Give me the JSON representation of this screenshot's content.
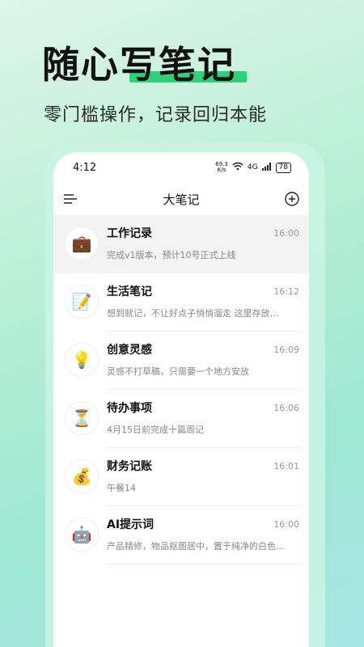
{
  "hero": {
    "title": "随心写笔记",
    "subtitle": "零门槛操作，记录回归本能"
  },
  "status_bar": {
    "time": "4:12",
    "network_speed": "69.3",
    "network_speed_unit": "K/s",
    "network_type": "4G",
    "battery": "78"
  },
  "app_header": {
    "title": "大笔记"
  },
  "notes": [
    {
      "icon": "💼",
      "icon_name": "briefcase-icon",
      "title": "工作记录",
      "time": "16:00",
      "preview": "完成v1版本，预计10号正式上线"
    },
    {
      "icon": "📝",
      "icon_name": "memo-icon",
      "title": "生活笔记",
      "time": "16:12",
      "preview": "想到就记，不让好点子悄悄溜走 这里存放…"
    },
    {
      "icon": "💡",
      "icon_name": "lightbulb-icon",
      "title": "创意灵感",
      "time": "16:09",
      "preview": "灵感不打草稿，只需要一个地方安放"
    },
    {
      "icon": "⏳",
      "icon_name": "hourglass-icon",
      "title": "待办事项",
      "time": "16:06",
      "preview": "4月15日前完成十篇周记"
    },
    {
      "icon": "💰",
      "icon_name": "money-bag-icon",
      "title": "财务记账",
      "time": "16:01",
      "preview": "午餐14"
    },
    {
      "icon": "🤖",
      "icon_name": "robot-icon",
      "title": "AI提示词",
      "time": "16:00",
      "preview": "产品精修，物品抠图居中，置于纯净的白色…"
    }
  ]
}
